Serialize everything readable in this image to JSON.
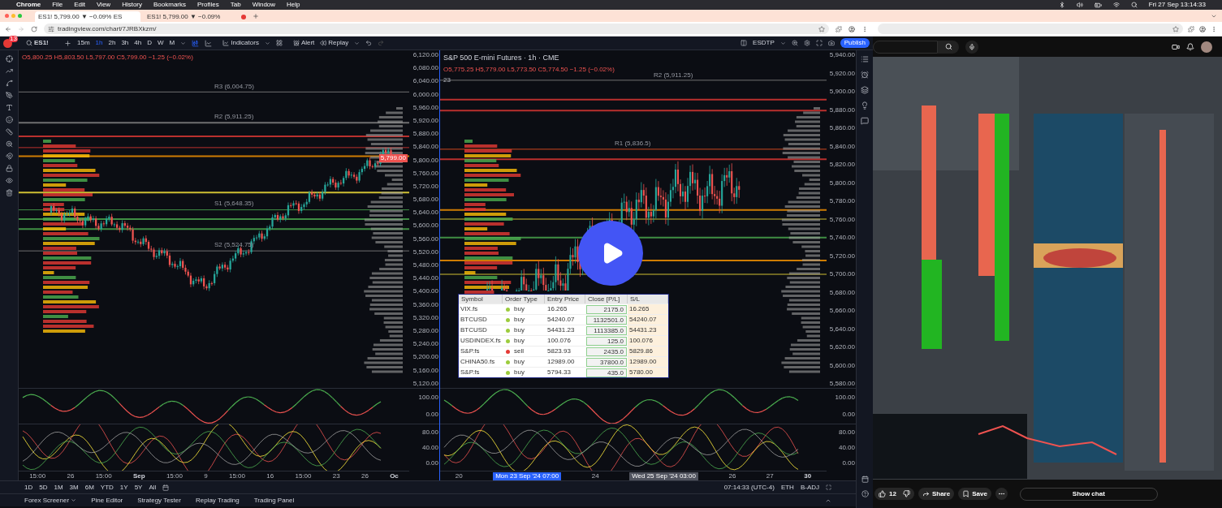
{
  "menu_bar": {
    "app": "Chrome",
    "items": [
      "File",
      "Edit",
      "View",
      "History",
      "Bookmarks",
      "Profiles",
      "Tab",
      "Window",
      "Help"
    ],
    "clock": "Fri 27 Sep 13:14:33"
  },
  "browser": {
    "tabs": [
      {
        "title": "ES1! 5,799.00 ▼ −0.09% ES",
        "selected": true,
        "recording": false
      },
      {
        "title": "ES1! 5,799.00 ▼ −0.09%",
        "selected": false,
        "recording": true
      }
    ],
    "address": "tradingview.com/chart/7JRBXkzm/"
  },
  "toolbar": {
    "badge": "13",
    "symbol": "ES1!",
    "intervals": [
      {
        "label": "15m",
        "selected": false
      },
      {
        "label": "1h",
        "selected": true
      },
      {
        "label": "2h",
        "selected": false
      },
      {
        "label": "3h",
        "selected": false
      },
      {
        "label": "4h",
        "selected": false
      },
      {
        "label": "D",
        "selected": false
      },
      {
        "label": "W",
        "selected": false
      },
      {
        "label": "M",
        "selected": false
      }
    ],
    "indicators": "Indicators",
    "alert": "Alert",
    "replay": "Replay",
    "layout": "ESDTP",
    "publish": "Publish"
  },
  "charts": [
    {
      "ohlc": "O5,800.25 H5,803.50 L5,797.00 C5,799.00 −1.25 (−0.02%)",
      "last_price": "5,799.00",
      "price_labels": [
        "6,120.00",
        "6,080.00",
        "6,040.00",
        "6,000.00",
        "5,960.00",
        "5,920.00",
        "5,880.00",
        "5,840.00",
        "5,800.00",
        "5,760.00",
        "5,720.00",
        "5,680.00",
        "5,640.00",
        "5,600.00",
        "5,560.00",
        "5,520.00",
        "5,480.00",
        "5,440.00",
        "5,400.00",
        "5,360.00",
        "5,320.00",
        "5,280.00",
        "5,240.00",
        "5,200.00",
        "5,160.00",
        "5,120.00"
      ],
      "level_labels": [
        "R3 (6,004.75)",
        "R2 (5,911.25)",
        "S1 (5,648.35)",
        "S2 (5,524.75)"
      ],
      "osc1_labels": [
        "100.00",
        "0.00"
      ],
      "osc2_labels": [
        "80.00",
        "40.00",
        "0.00"
      ],
      "time_labels": [
        {
          "text": "15:00",
          "kind": "tick"
        },
        {
          "text": "26",
          "kind": "tick"
        },
        {
          "text": "15:00",
          "kind": "tick"
        },
        {
          "text": "Sep",
          "kind": "bold"
        },
        {
          "text": "15:00",
          "kind": "tick"
        },
        {
          "text": "9",
          "kind": "tick"
        },
        {
          "text": "15:00",
          "kind": "tick"
        },
        {
          "text": "16",
          "kind": "tick"
        },
        {
          "text": "15:00",
          "kind": "tick"
        },
        {
          "text": "23",
          "kind": "tick"
        },
        {
          "text": "26",
          "kind": "tick"
        },
        {
          "text": "Oc",
          "kind": "bold"
        }
      ]
    },
    {
      "legend": "S&P 500 E-mini Futures · 1h · CME",
      "ohlc": "O5,775.25 H5,779.00 L5,773.50 C5,774.50 −1.25 (−0.02%)",
      "sub_label": "23",
      "price_labels": [
        "5,940.00",
        "5,920.00",
        "5,900.00",
        "5,880.00",
        "5,860.00",
        "5,840.00",
        "5,820.00",
        "5,800.00",
        "5,780.00",
        "5,760.00",
        "5,740.00",
        "5,720.00",
        "5,700.00",
        "5,680.00",
        "5,660.00",
        "5,640.00",
        "5,620.00",
        "5,600.00",
        "5,580.00"
      ],
      "level_labels": [
        "R2 (5,911.25)",
        "R1 (5,836.5)"
      ],
      "osc1_labels": [
        "100.00",
        "0.00"
      ],
      "osc2_labels": [
        "80.00",
        "40.00",
        "0.00"
      ],
      "time_labels": [
        {
          "text": "20",
          "kind": "tick"
        },
        {
          "text": "Mon 23 Sep '24  07:00",
          "kind": "cursor"
        },
        {
          "text": "24",
          "kind": "tick"
        },
        {
          "text": "Wed 25 Sep '24  03:00",
          "kind": "marker"
        },
        {
          "text": "26",
          "kind": "tick"
        },
        {
          "text": "27",
          "kind": "tick"
        },
        {
          "text": "30",
          "kind": "bold"
        }
      ]
    }
  ],
  "order_table": {
    "columns": [
      "Symbol",
      "Order Type",
      "Entry Price",
      "Close [P/L]",
      "S/L"
    ],
    "rows": [
      {
        "symbol": "VIX.fs",
        "order_type": "buy",
        "color": "#9ccc3c",
        "entry_price": "16.265",
        "close": "2175.0",
        "sl": "16.265"
      },
      {
        "symbol": "BTCUSD",
        "order_type": "buy",
        "color": "#9ccc3c",
        "entry_price": "54240.07",
        "close": "1132501.0",
        "sl": "54240.07"
      },
      {
        "symbol": "BTCUSD",
        "order_type": "buy",
        "color": "#9ccc3c",
        "entry_price": "54431.23",
        "close": "1113385.0",
        "sl": "54431.23"
      },
      {
        "symbol": "USDINDEX.fs",
        "order_type": "buy",
        "color": "#9ccc3c",
        "entry_price": "100.076",
        "close": "125.0",
        "sl": "100.076"
      },
      {
        "symbol": "S&P.fs",
        "order_type": "sell",
        "color": "#e53935",
        "entry_price": "5823.93",
        "close": "2435.0",
        "sl": "5829.86"
      },
      {
        "symbol": "CHINA50.fs",
        "order_type": "buy",
        "color": "#9ccc3c",
        "entry_price": "12989.00",
        "close": "37800.0",
        "sl": "12989.00"
      },
      {
        "symbol": "S&P.fs",
        "order_type": "buy",
        "color": "#9ccc3c",
        "entry_price": "5794.33",
        "close": "435.0",
        "sl": "5780.00"
      }
    ]
  },
  "range_buttons": [
    "1D",
    "5D",
    "1M",
    "3M",
    "6M",
    "YTD",
    "1Y",
    "5Y",
    "All"
  ],
  "status": {
    "time": "07:14:33 (UTC-4)",
    "session": "ETH",
    "adjust": "B-ADJ"
  },
  "bottom_tabs": [
    {
      "label": "Forex Screener",
      "menu": true
    },
    {
      "label": "Pine Editor",
      "menu": false
    },
    {
      "label": "Strategy Tester",
      "menu": false
    },
    {
      "label": "Replay Trading",
      "menu": false
    },
    {
      "label": "Trading Panel",
      "menu": false
    }
  ],
  "video_page": {
    "like_count": "12",
    "share": "Share",
    "save": "Save",
    "show_chat": "Show chat"
  }
}
